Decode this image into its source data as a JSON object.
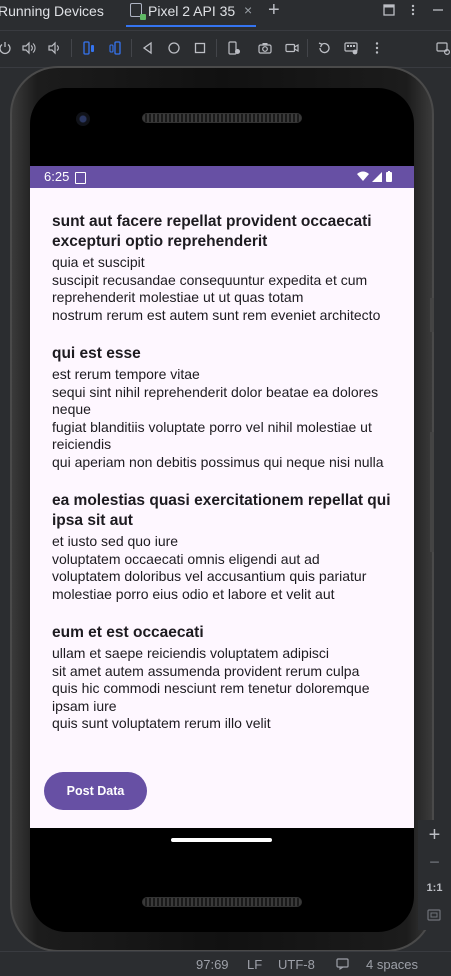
{
  "ide": {
    "tool_window_title": "Running Devices",
    "device_tab": "Pixel 2 API 35",
    "close_glyph": "×",
    "new_tab_glyph": "+"
  },
  "status_footer": {
    "position": "97:69",
    "line_separator": "LF",
    "encoding": "UTF-8",
    "indent": "4 spaces"
  },
  "phone": {
    "status_time": "6:25",
    "posts": [
      {
        "title": "sunt aut facere repellat provident occaecati excepturi optio reprehenderit",
        "body": "quia et suscipit\nsuscipit recusandae consequuntur expedita et cum reprehenderit molestiae ut ut quas totam\nnostrum rerum est autem sunt rem eveniet architecto"
      },
      {
        "title": "qui est esse",
        "body": "est rerum tempore vitae\nsequi sint nihil reprehenderit dolor beatae ea dolores neque\nfugiat blanditiis voluptate porro vel nihil molestiae ut reiciendis\nqui aperiam non debitis possimus qui neque nisi nulla"
      },
      {
        "title": "ea molestias quasi exercitationem repellat qui ipsa sit aut",
        "body": "et iusto sed quo iure\nvoluptatem occaecati omnis eligendi aut ad\nvoluptatem doloribus vel accusantium quis pariatur\nmolestiae porro eius odio et labore et velit aut"
      },
      {
        "title": "eum et est occaecati",
        "body": "ullam et saepe reiciendis voluptatem adipisci\nsit amet autem assumenda provident rerum culpa\nquis hic commodi nesciunt rem tenetur doloremque ipsam iure\nquis sunt voluptatem rerum illo velit"
      }
    ],
    "fab_label": "Post Data"
  },
  "emulator_panel": {
    "zoom_in": "+",
    "zoom_out": "−",
    "actual_size": "1:1"
  },
  "colors": {
    "primary": "#6750a4",
    "screen_bg": "#fef7ff",
    "ide_bg": "#2b2d30"
  }
}
